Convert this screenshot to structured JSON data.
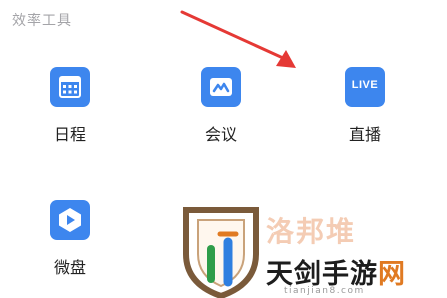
{
  "section": {
    "title": "效率工具"
  },
  "tools": [
    {
      "label": "日程",
      "icon": "calendar-icon"
    },
    {
      "label": "会议",
      "icon": "meeting-icon"
    },
    {
      "label": "直播",
      "icon": "live-icon",
      "badge": "LIVE"
    },
    {
      "label": "微盘",
      "icon": "cloud-drive-icon"
    }
  ],
  "watermark": {
    "brand_prefix": "天剑手游",
    "brand_suffix": "网",
    "url": "tianjian8.com",
    "faded_text": "洛邦堆"
  },
  "colors": {
    "icon_blue": "#3d86ee",
    "arrow_red": "#e53935",
    "watermark_orange": "#e07a22"
  }
}
